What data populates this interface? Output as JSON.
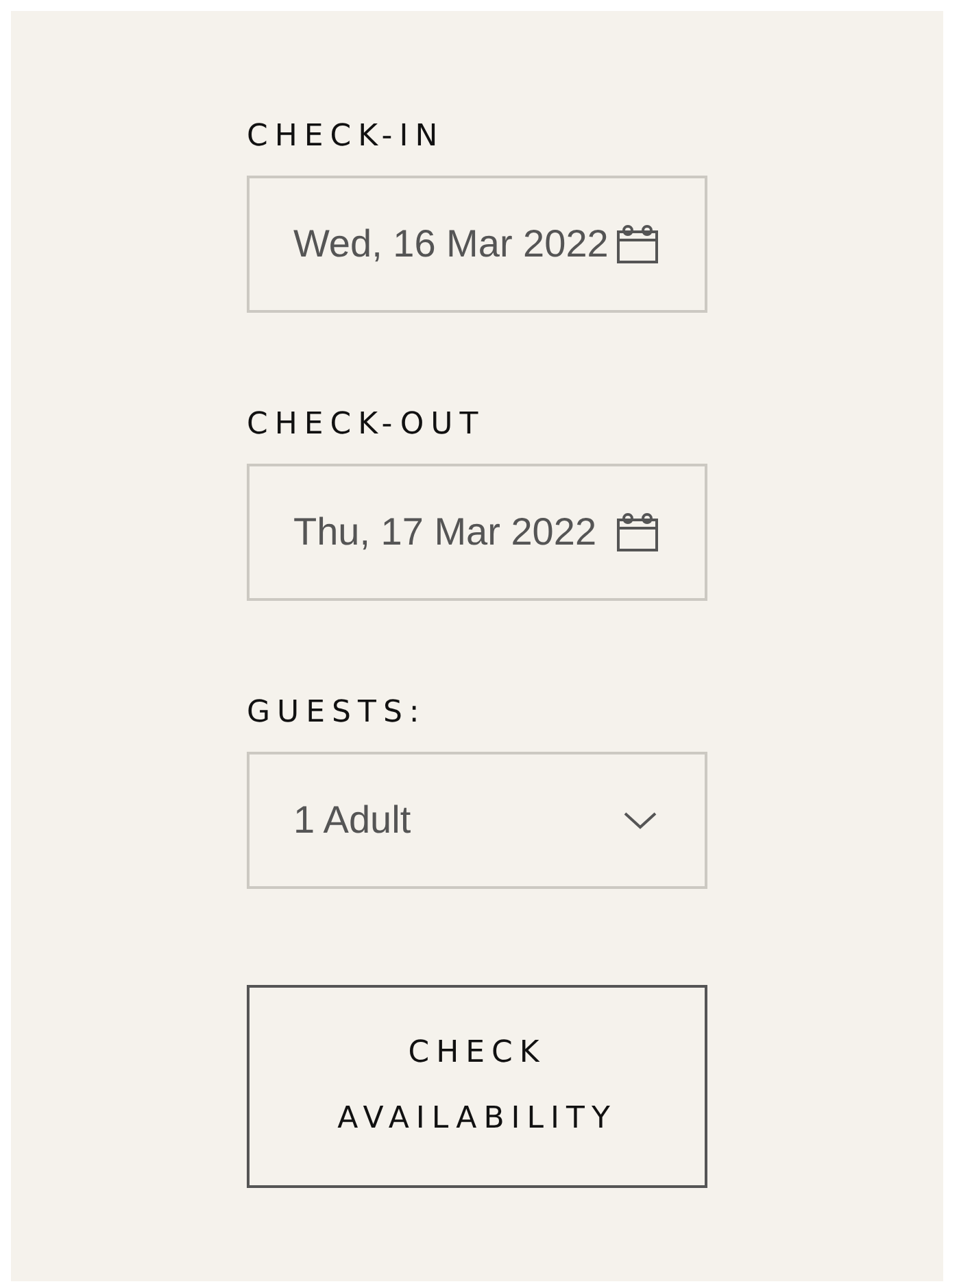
{
  "fields": [
    {
      "kind": "date",
      "label": "CHECK-IN",
      "value": "Wed, 16 Mar 2022"
    },
    {
      "kind": "date",
      "label": "CHECK-OUT",
      "value": "Thu, 17 Mar 2022"
    },
    {
      "kind": "select",
      "label": "GUESTS:",
      "value": "1 Adult"
    }
  ],
  "button": {
    "label": "CHECK AVAILABILITY"
  }
}
